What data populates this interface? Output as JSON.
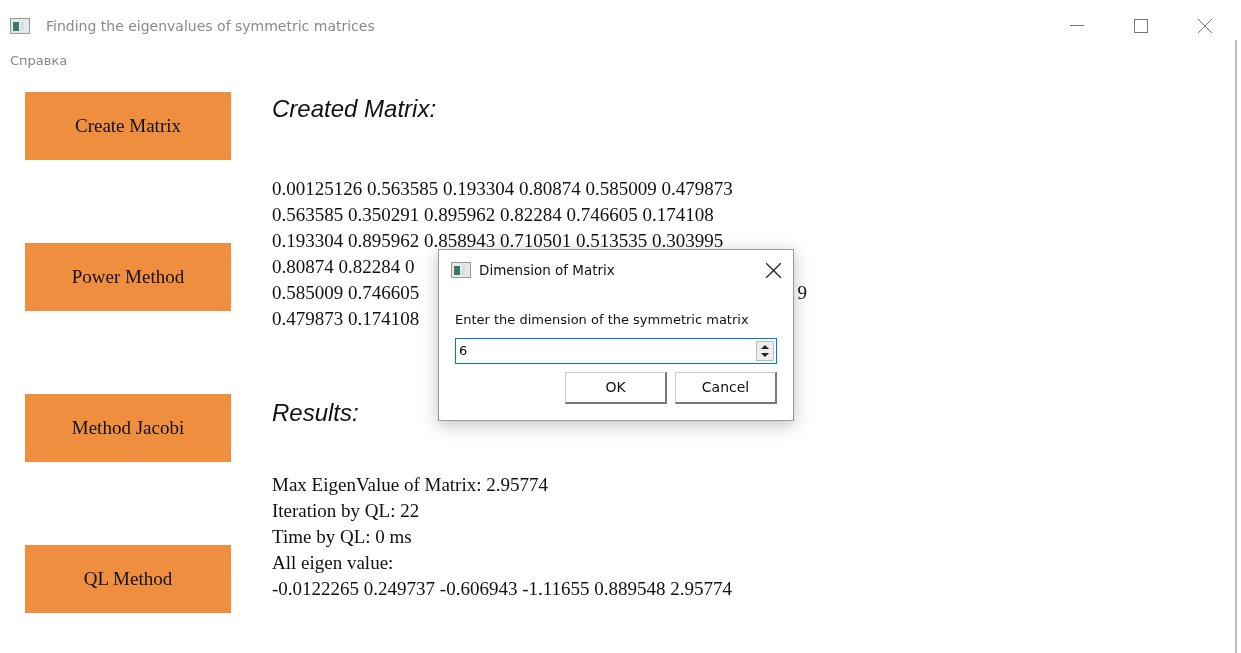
{
  "window": {
    "title": "Finding the eigenvalues of symmetric matrices"
  },
  "menu": [
    "Справка"
  ],
  "buttons": [
    "Create Matrix",
    "Power Method",
    "Method Jacobi",
    "QL Method"
  ],
  "matrix": {
    "heading": "Created Matrix:",
    "rows": [
      {
        "text": "0.00125126 0.563585 0.193304 0.80874 0.585009 0.479873"
      },
      {
        "text": "0.563585 0.350291 0.895962 0.82284 0.746605 0.174108"
      },
      {
        "text": "0.193304 0.895962 0.858943 0.710501 0.513535 0.303995"
      },
      {
        "text": "0.80874 0.82284 0"
      },
      {
        "text": "0.585009 0.746605",
        "tail": "9"
      },
      {
        "text": "0.479873 0.174108"
      }
    ]
  },
  "results": {
    "heading": "Results:",
    "lines": [
      "Max EigenValue of Matrix: 2.95774",
      "Iteration by QL: 22",
      "Time by QL: 0 ms",
      "All eigen value:",
      "-0.0122265 0.249737 -0.606943 -1.11655 0.889548 2.95774"
    ]
  },
  "dialog": {
    "title": "Dimension of Matrix",
    "prompt": "Enter the dimension of the symmetric matrix",
    "value": "6",
    "buttons": [
      "OK",
      "Cancel"
    ]
  }
}
